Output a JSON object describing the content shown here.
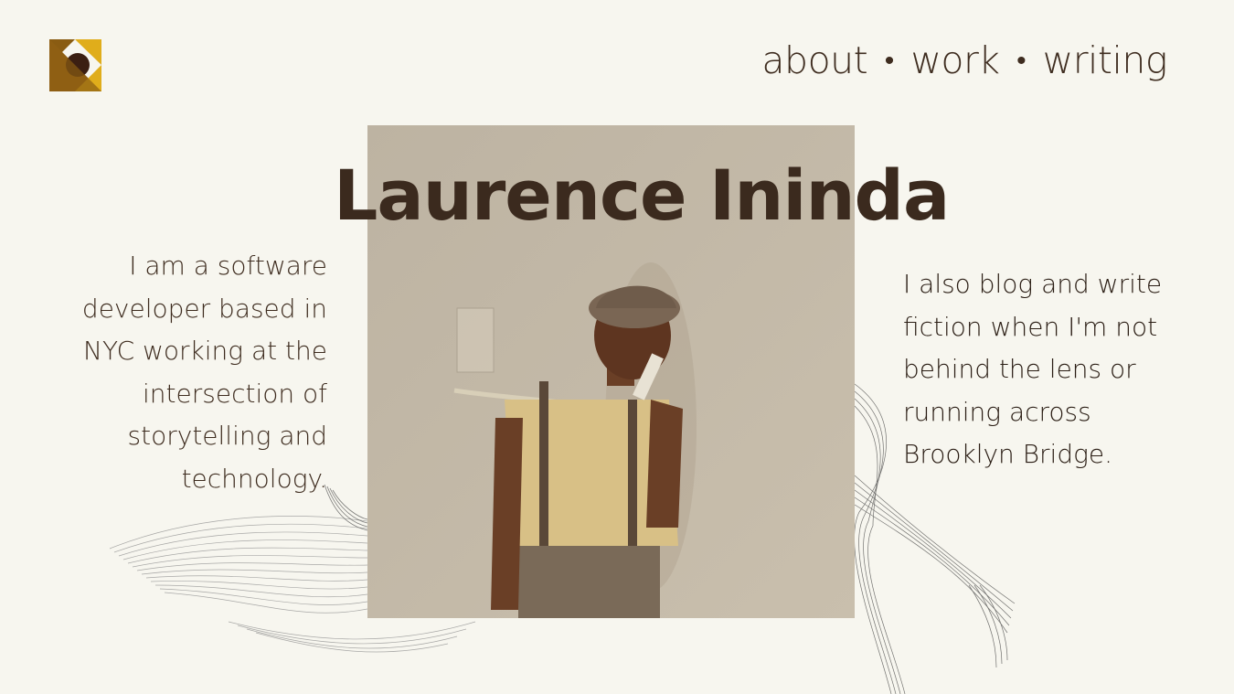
{
  "logo": {
    "icon": "logo-icon",
    "colors": [
      "#e0ad1b",
      "#8a5c12",
      "#3b1f12"
    ]
  },
  "nav": {
    "items": [
      {
        "label": "about"
      },
      {
        "label": "work"
      },
      {
        "label": "writing"
      }
    ],
    "separator": "•"
  },
  "hero": {
    "name": "Laurence Ininda",
    "left_lines": [
      "I am a software",
      "developer based in",
      "NYC working at the",
      "intersection of",
      "storytelling and",
      "technology."
    ],
    "right_lines": [
      "I also blog and write",
      "fiction when I'm not",
      "behind the lens or",
      "running across",
      "Brooklyn Bridge."
    ]
  },
  "colors": {
    "background": "#f7f6ef",
    "text": "#3e2c1f"
  }
}
